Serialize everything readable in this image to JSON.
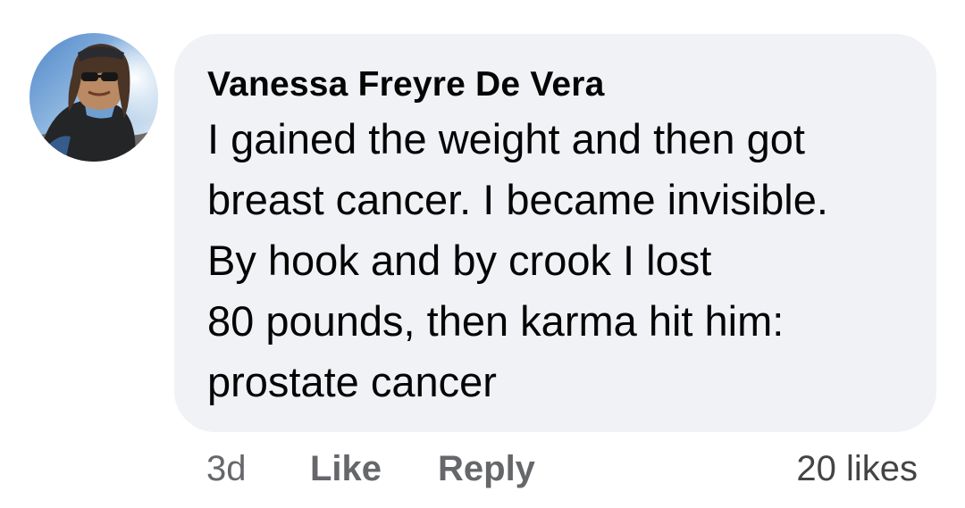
{
  "comment": {
    "author": "Vanessa Freyre De Vera",
    "text_lines": [
      "I gained the weight and then got",
      "breast cancer. I became invisible.",
      "By hook and by crook I lost",
      "80 pounds, then karma hit him:",
      "prostate cancer"
    ],
    "time": "3d",
    "like_label": "Like",
    "reply_label": "Reply",
    "likes_count": "20 likes"
  },
  "colors": {
    "bubble": "#f0f2f5",
    "text": "#050505",
    "meta": "#65676b"
  }
}
